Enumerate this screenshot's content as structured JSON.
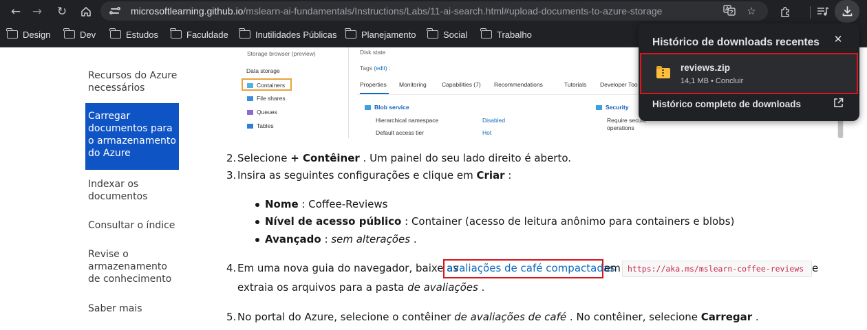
{
  "browser": {
    "url_domain": "microsoftlearning.github.io",
    "url_path": "/mslearn-ai-fundamentals/Instructions/Labs/11-ai-search.html#upload-documents-to-azure-storage",
    "bookmarks": [
      "Design",
      "Dev",
      "Estudos",
      "Faculdade",
      "Inutilidades Públicas",
      "Planejamento",
      "Social",
      "Trabalho"
    ],
    "icons": {
      "back": "arrow-left-icon",
      "forward": "arrow-right-icon",
      "reload": "reload-icon",
      "home": "home-icon",
      "site_info": "tune-icon",
      "translate": "translate-icon",
      "bookmark": "star-icon",
      "extensions": "puzzle-icon",
      "media": "media-controls-icon",
      "downloads": "download-icon"
    }
  },
  "downloads_popup": {
    "title": "Histórico de downloads recentes",
    "item_name": "reviews.zip",
    "item_meta": "14,1 MB • Concluir",
    "full_history": "Histórico completo de downloads",
    "highlight_color": "#e0141d"
  },
  "left_nav": {
    "items": [
      "Recursos do Azure necessários",
      "Carregar documentos para o armazenamento do Azure",
      "Indexar os documentos",
      "Consultar o índice",
      "Revise o armazenamento de conhecimento",
      "Saber mais"
    ],
    "active_color": "#0f54c5"
  },
  "portal_screenshot": {
    "storage_browser": "Storage browser (preview)",
    "data_storage": "Data storage",
    "containers": "Containers",
    "file_shares": "File shares",
    "queues": "Queues",
    "tables": "Tables",
    "disk_state": "Disk state",
    "tags_label": "Tags",
    "tags_edit": "(edit)",
    "tags_sep": ":",
    "tabs": [
      "Properties",
      "Monitoring",
      "Capabilities (7)",
      "Recommendations",
      "Tutorials",
      "Developer Too"
    ],
    "blob_service": "Blob service",
    "hierarchical_namespace": "Hierarchical namespace",
    "hierarchical_value": "Disabled",
    "default_access_tier": "Default access tier",
    "access_tier_value": "Hot",
    "security": "Security",
    "require_secure": "Require secure",
    "operations": "operations",
    "highlight_color": "#e8a33d"
  },
  "content": {
    "step2_num": "2.",
    "step2_pre": "Selecione ",
    "step2_bold": "+ Contêiner",
    "step2_post": " . Um painel do seu lado direito é aberto.",
    "step3_num": "3.",
    "step3_pre": "Insira as seguintes configurações e clique em ",
    "step3_bold": "Criar",
    "step3_post": " :",
    "bullet1_bold": "Nome",
    "bullet1_text": " : Coffee-Reviews",
    "bullet2_bold": "Nível de acesso público",
    "bullet2_text": " : Container (acesso de leitura anônimo para containers e blobs)",
    "bullet3_bold": "Avançado",
    "bullet3_sep": " : ",
    "bullet3_em": "sem alterações",
    "bullet3_end": " .",
    "step4_num": "4.",
    "step4_pre": "Em uma nova guia do navegador, baixe as",
    "step4_link": "avaliações de café compactadas",
    "step4_mid": "em",
    "step4_code": "https://aka.ms/mslearn-coffee-reviews",
    "step4_end": "e",
    "step4_line2_pre": "extraia os arquivos para a pasta ",
    "step4_line2_em": "de avaliações",
    "step4_line2_end": " .",
    "step5_num": "5.",
    "step5_pre": "No portal do Azure, selecione o contêiner ",
    "step5_em": "de avaliações de café",
    "step5_mid": " . No contêiner, selecione ",
    "step5_bold": "Carregar",
    "step5_end": " .",
    "highlight_color": "#d8131b"
  }
}
